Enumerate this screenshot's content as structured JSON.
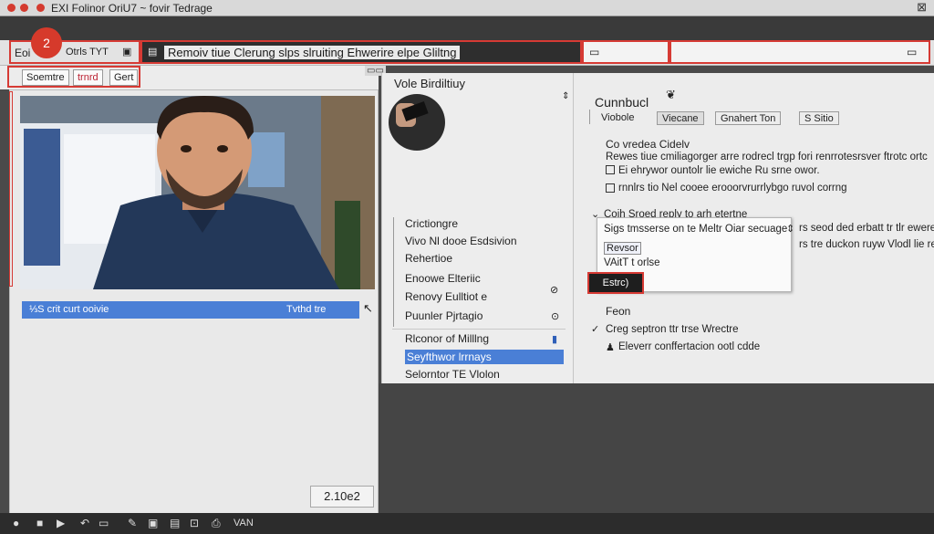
{
  "window": {
    "title": "EXI Folinor OriU7  ~ fovir Tedrage",
    "close_glyph": "⊠",
    "badge_number": "2"
  },
  "toolbar": {
    "left_label": "Eoi",
    "mid_label": "Otrls TYT",
    "command": "Remoiv tiue Clerung slps slruiting Ehwerire elpe Gliltng",
    "field1_icon": "▭",
    "field2_icon": "▭"
  },
  "subtoolbar": {
    "chips": [
      "Soemtre",
      "trnrd",
      "Gert"
    ]
  },
  "left_panel": {
    "selected_row_left": "⅓S crit curt ooivie",
    "selected_row_right": "Tvthd tre",
    "timecode": "2.10e2"
  },
  "mid_panel": {
    "header": "Vole Birdiltiuy",
    "menu_items": [
      "Crictiongre",
      "Vivo Nl dooe Esdsivion",
      "Rehertioe",
      "Enoowe Elteriic",
      "Renovy Eulltiot e",
      "Puunler Pjrtagio",
      "Rlconor of Milllng",
      "Seyfthwor lrrnays",
      "Selorntor TE Vlolon"
    ],
    "selected_index": 7
  },
  "right_panel": {
    "title": "Cunnbucl",
    "tabs": [
      "Viobole",
      "Viecane",
      "Gnahert Ton",
      "S Sitio"
    ],
    "active_tab": 1,
    "section1_title": "Co vredea Cidelv",
    "section1_lines": [
      "Rewes tiue cmiliagorger arre rodrecl trgp fori renrrotesrsver ftrotc ortc",
      "Ei ehrywor ountolr lie ewiche Ru srne owor.",
      "rnnlrs tio Nel cooee erooorvrurrlybgo ruvol corrng"
    ],
    "section2_title": "Coih Sroed reply to arh etertne",
    "section2_line": "Sigs tmsserse on te Meltr Oiar secuage",
    "side_lines": [
      "rs seod ded erbatt tr tlr ewere",
      "rs tre duckon ruyw Vlodl lie res"
    ],
    "popup_items": [
      "Revsor",
      "VAitT t orlse"
    ],
    "popup_button": "Estrc)",
    "footer_title": "Feon",
    "footer_lines": [
      "Creg septron ttr trse Wrectre",
      "Eleverr conffertacion ootl cdde"
    ]
  },
  "statusbar": {
    "label": "VAN"
  }
}
